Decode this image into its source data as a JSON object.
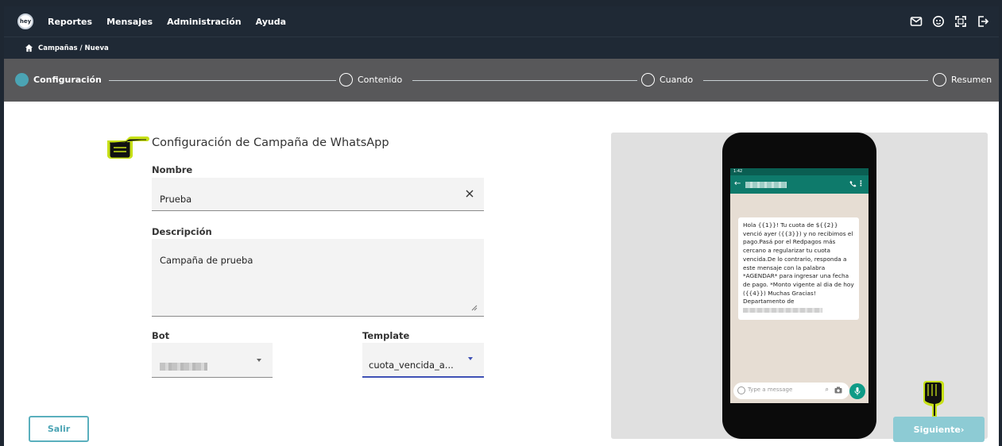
{
  "app": {
    "logo_text": "hey"
  },
  "nav": {
    "items": [
      "Reportes",
      "Mensajes",
      "Administración",
      "Ayuda"
    ]
  },
  "header_icons": [
    "mail-icon",
    "smiley-icon",
    "fullscreen-icon",
    "logout-icon"
  ],
  "breadcrumb": {
    "text": "Campañas / Nueva",
    "icon": "home-icon"
  },
  "stepper": {
    "steps": [
      {
        "label": "Configuración",
        "active": true
      },
      {
        "label": "Contenido",
        "active": false
      },
      {
        "label": "Cuando",
        "active": false
      },
      {
        "label": "Resumen",
        "active": false
      }
    ]
  },
  "form": {
    "title": "Configuración de Campaña de WhatsApp",
    "nombre": {
      "label": "Nombre",
      "value": "Prueba"
    },
    "descripcion": {
      "label": "Descripción",
      "value": "Campaña de prueba"
    },
    "bot": {
      "label": "Bot",
      "value": ""
    },
    "template": {
      "label": "Template",
      "value": "cuota_vencida_a..."
    }
  },
  "preview": {
    "status_time": "1:42",
    "message": "Hola {{1}}! Tu cuota de ${{2}} venció ayer ({{3}}) y no recibimos el pago.Pasá por el Redpagos más cercano a regularizar tu cuota vencida.De lo contrario, responda a este mensaje con la palabra *AGENDAR* para ingresar una fecha de pago. *Monto vigente al dia de hoy ({{4}}) Muchas Gracias! Departamento de",
    "input_placeholder": "Type a message"
  },
  "buttons": {
    "salir": "Salir",
    "siguiente": "Siguiente›"
  },
  "colors": {
    "nav_bg": "#1f2935",
    "stepper_bg": "#58585a",
    "accent": "#4ba4b4",
    "wa_green": "#0e7a6b"
  }
}
